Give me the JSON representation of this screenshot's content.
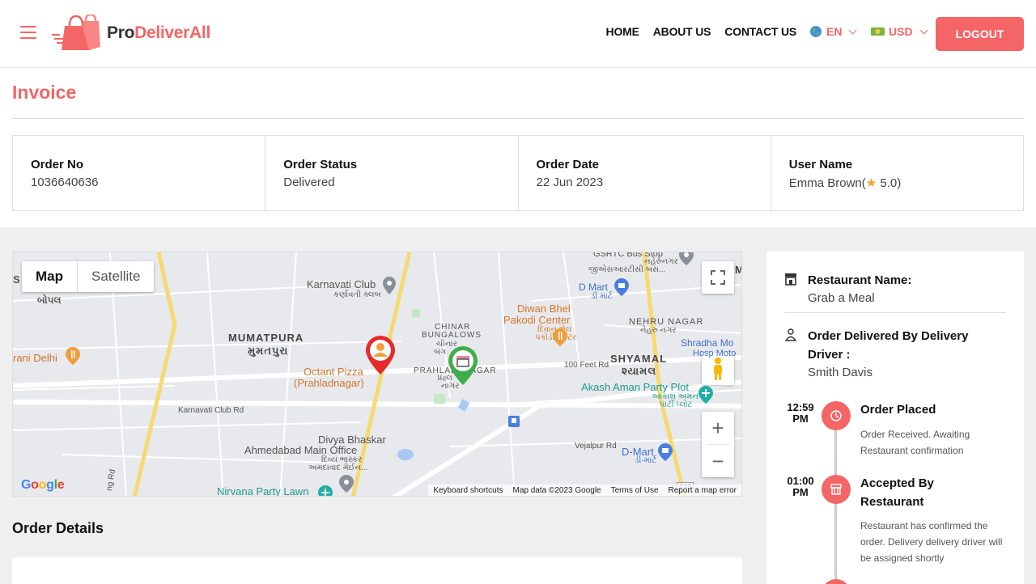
{
  "header": {
    "logo_pro": "Pro",
    "logo_deliverall": "DeliverAll",
    "nav": [
      "HOME",
      "ABOUT US",
      "CONTACT US"
    ],
    "language": "EN",
    "currency": "USD",
    "logout_label": "LOGOUT"
  },
  "invoice": {
    "title": "Invoice",
    "fields": [
      {
        "label": "Order No",
        "value": "1036640636"
      },
      {
        "label": "Order Status",
        "value": "Delivered"
      },
      {
        "label": "Order Date",
        "value": "22 Jun 2023"
      },
      {
        "label": "User Name",
        "value_prefix": "Emma Brown(",
        "rating": "5.0",
        "value_suffix": ")"
      }
    ]
  },
  "map": {
    "tab_map": "Map",
    "tab_satellite": "Satellite",
    "labels": {
      "mumatpura": "MUMATPURA",
      "mumatpura_gu": "મુમતપુરા",
      "karnavati_club": "Karnavati Club",
      "karnavati_club_gu": "કર્ણાવતી ક્લબ",
      "chinar": "CHINAR",
      "bungalows": "BUNGALOWS",
      "chinar_gu": "ચીનાર",
      "bangla_gu": "બંગ",
      "prahlad": "PRAHLAD",
      "nagar": "NAGAR",
      "prahlad_gu": "પ્રહ્લ",
      "nagar_gu": "નાગર",
      "shyamal": "SHYAMAL",
      "shyamal_gu": "શ્યામલ",
      "nehru_nagar": "NEHRU NAGAR",
      "nehru_nagar_gu": "નેહરુ નગર",
      "diwan_bhel": "Diwan Bhel",
      "pakodi_center": "Pakodi Center",
      "diwan_gu": "દિવાન ભેલ",
      "pakodi_gu": "પકોડી સેન્ટર",
      "dmart_top": "D Mart",
      "dmart_top_gu": "ડી માર્ટ",
      "gsrtc": "GSRTC Bus Stop",
      "gsrtc_gu1": "જીએસઆરટીસી બસ...",
      "gsrtc_gu2": "નહેરુનગર",
      "shradha": "Shradha Mo",
      "shradha2": "Hosp Moto",
      "akash": "Akash Aman Party Plot",
      "akash_gu1": "આકાશ અમન",
      "akash_gu2": "પાર્ટી પ્લોટ",
      "octant": "Octant Pizza",
      "octant2": "(Prahladnagar)",
      "divya1": "Divya Bhaskar",
      "divya2": "Ahmedabad Main Office",
      "divya_gu1": "દિવ્ય ભાસ્કર",
      "divya_gu2": "અમદાવાદ મેઈન...",
      "nirvana": "Nirvana Party Lawn",
      "dmart_bottom": "D-Mart",
      "dmart_bottom_gu": "ડી-માર્ટ",
      "rani_delhi": "rani Delhi",
      "bopal_s": "S",
      "bopal_gu": "બોપલ",
      "road_100ft": "100 Feet Rd",
      "road_karnavati": "Karnavati Club Rd",
      "road_vejalpur": "Vejalpur Rd",
      "road_ng": "ng Rd",
      "road_228": "228",
      "road_m": "M"
    },
    "footer": [
      "Keyboard shortcuts",
      "Map data ©2023 Google",
      "Terms of Use",
      "Report a map error"
    ],
    "google": "Google"
  },
  "order_details": {
    "title": "Order Details"
  },
  "panel": {
    "restaurant_label": "Restaurant Name:",
    "restaurant_value": "Grab a Meal",
    "driver_label_1": "Order Delivered By Delivery",
    "driver_label_2": "Driver :",
    "driver_value": "Smith Davis",
    "timeline": [
      {
        "time_1": "12:59",
        "time_2": "PM",
        "title": "Order Placed",
        "desc": "Order Received. Awaiting Restaurant confirmation"
      },
      {
        "time_1": "01:00",
        "time_2": "PM",
        "title_1": "Accepted By",
        "title_2": "Restaurant",
        "desc": "Restaurant has confirmed the order. Delivery delivery driver will be assigned shortly"
      }
    ]
  },
  "colors": {
    "accent": "#f46565",
    "star": "#f7a01e"
  }
}
